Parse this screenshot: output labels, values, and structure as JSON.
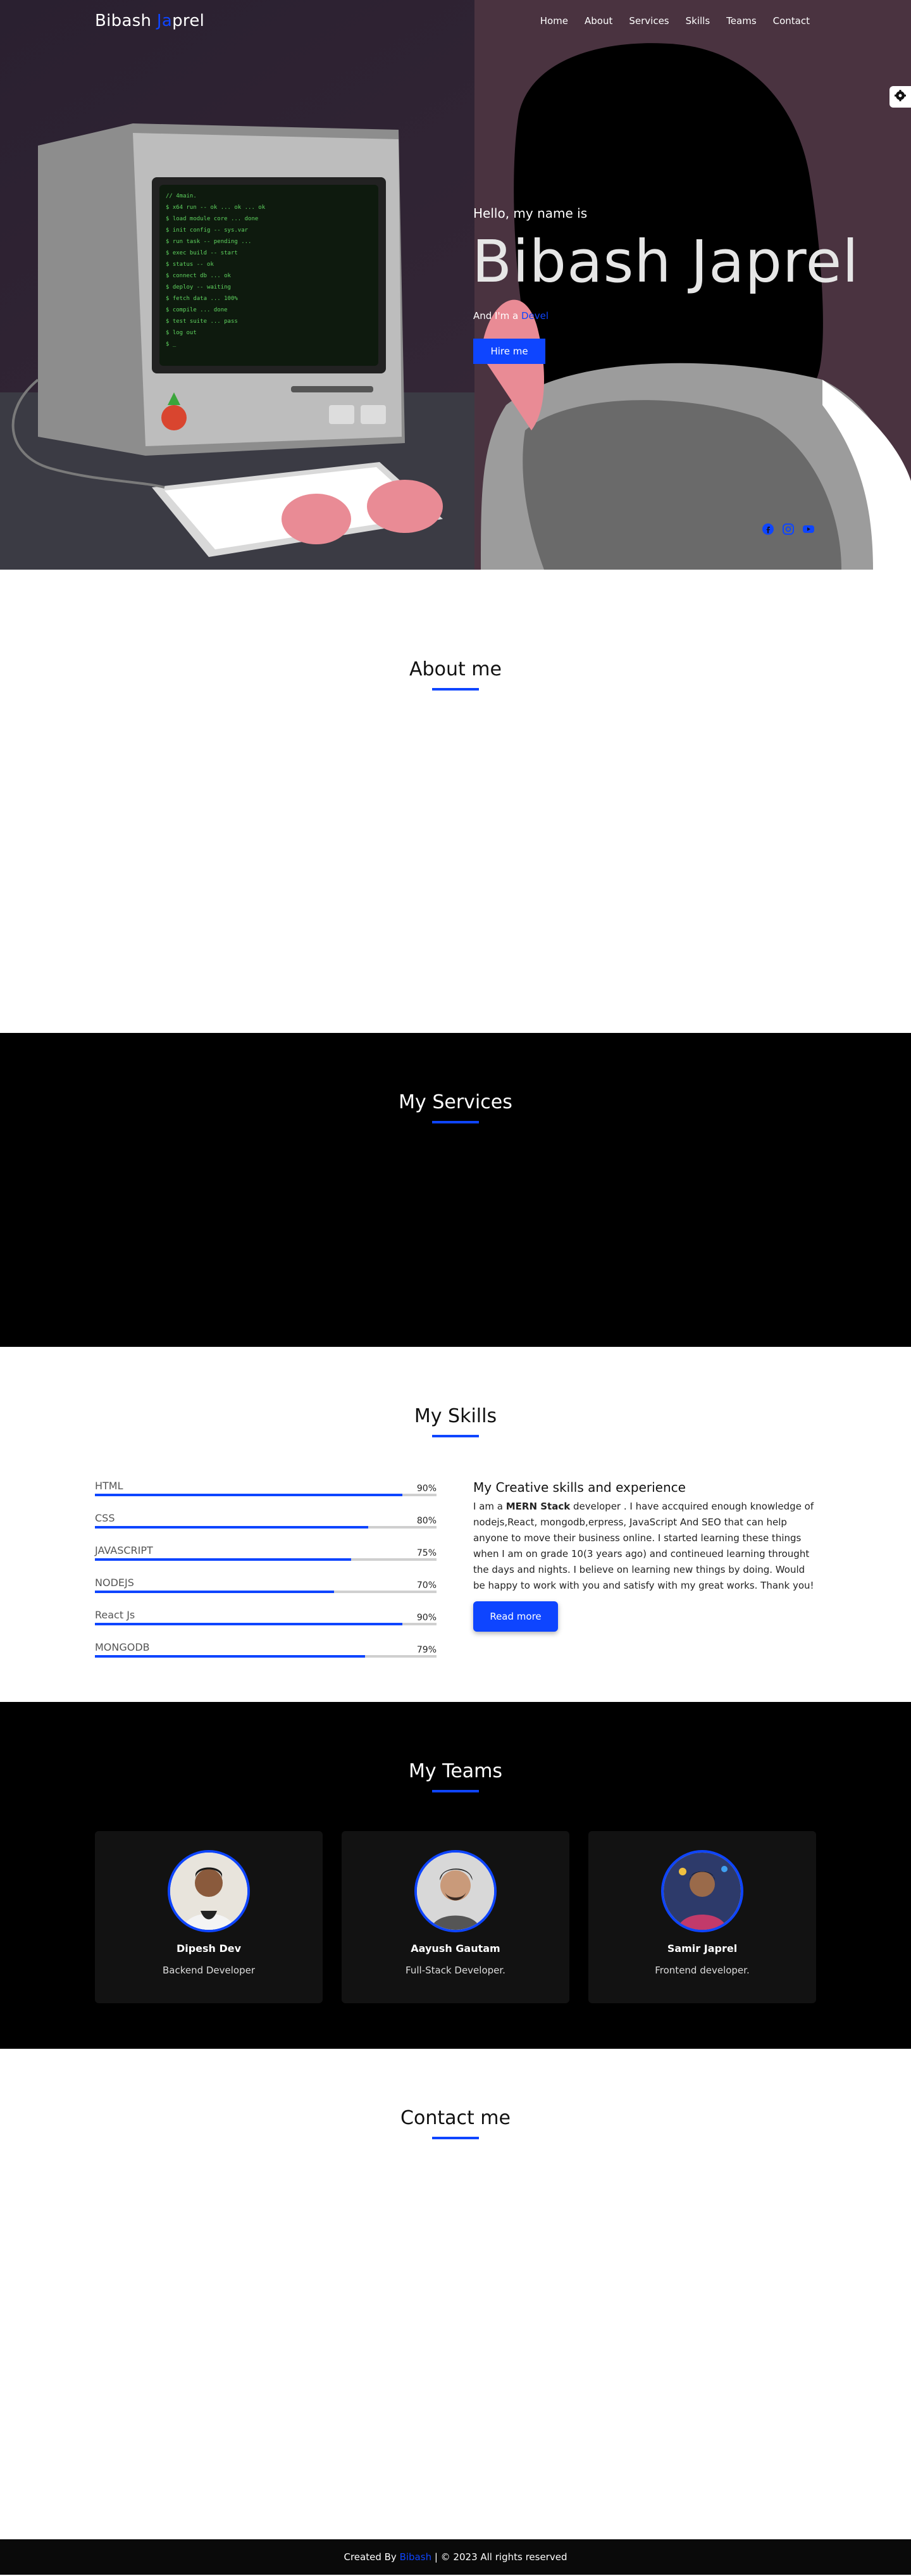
{
  "nav": {
    "logo_part1": "Bibash ",
    "logo_part2": "Ja",
    "logo_part3": "prel",
    "items": [
      "Home",
      "About",
      "Services",
      "Skills",
      "Teams",
      "Contact"
    ]
  },
  "hero": {
    "greeting": "Hello, my name is",
    "name": "Bibash Japrel",
    "role_prefix": "And I'm a ",
    "role_typed": "Devel",
    "hire_label": "Hire me",
    "socials": [
      "facebook-icon",
      "instagram-icon",
      "youtube-icon"
    ]
  },
  "sections": {
    "about_title": "About me",
    "services_title": "My Services",
    "skills_title": "My Skills",
    "teams_title": "My Teams",
    "contact_title": "Contact me"
  },
  "skills": {
    "items": [
      {
        "name": "HTML",
        "percent": "90%",
        "value": 90
      },
      {
        "name": "CSS",
        "percent": "80%",
        "value": 80
      },
      {
        "name": "JAVASCRIPT",
        "percent": "75%",
        "value": 75
      },
      {
        "name": "NODEJS",
        "percent": "70%",
        "value": 70
      },
      {
        "name": "React Js",
        "percent": "90%",
        "value": 90
      },
      {
        "name": "MONGODB",
        "percent": "79%",
        "value": 79
      }
    ],
    "heading": "My Creative skills and experience",
    "para_before": "I am a ",
    "para_bold": "MERN Stack",
    "para_after": " developer . I have accquired enough knowledge of nodejs,React, mongodb,erpress, JavaScript And SEO that can help anyone to move their business online. I started learning these things when I am on grade 10(3 years ago) and contineued learning throught the days and nights. I believe on learning new things by doing. Would be happy to work with you and satisfy with my great works. Thank you!",
    "button_label": "Read more"
  },
  "teams": {
    "members": [
      {
        "name": "Dipesh Dev",
        "role": "Backend Developer"
      },
      {
        "name": "Aayush Gautam",
        "role": "Full-Stack Developer."
      },
      {
        "name": "Samir Japrel",
        "role": "Frontend developer."
      }
    ]
  },
  "footer": {
    "prefix": "Created By ",
    "author": "Bibash",
    "suffix": " | © 2023 All rights reserved"
  },
  "colors": {
    "accent": "#0e45ff",
    "dark": "#000000"
  }
}
